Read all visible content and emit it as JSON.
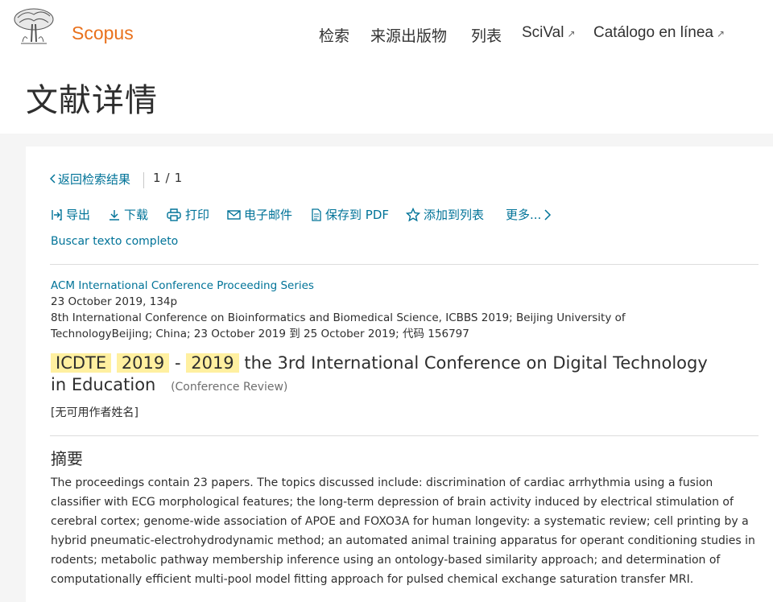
{
  "header": {
    "brand": "Scopus",
    "nav": [
      {
        "label": "检索",
        "external": false
      },
      {
        "label": "来源出版物",
        "external": false
      },
      {
        "label": "列表",
        "external": false
      },
      {
        "label": "SciVal",
        "external": true
      },
      {
        "label": "Catálogo en línea",
        "external": true
      }
    ],
    "external_icon": "↗",
    "page_title": "文献详情"
  },
  "toolbar": {
    "back_label": "返回检索结果",
    "pager_current": "1",
    "pager_sep": "/",
    "pager_total": "1",
    "actions": [
      {
        "label": "导出",
        "icon": "export-icon"
      },
      {
        "label": "下载",
        "icon": "download-icon"
      },
      {
        "label": "打印",
        "icon": "print-icon"
      },
      {
        "label": "电子邮件",
        "icon": "email-icon"
      },
      {
        "label": "保存到 PDF",
        "icon": "pdf-icon"
      },
      {
        "label": "添加到列表",
        "icon": "star-icon"
      },
      {
        "label": "更多...",
        "icon": "chevron-right-icon"
      }
    ],
    "fulltext_link": "Buscar texto completo"
  },
  "document": {
    "series": "ACM International Conference Proceeding Series",
    "date_pages": "23 October 2019, 134p",
    "conference_line1": "8th International Conference on Bioinformatics and Biomedical Science, ICBBS 2019; Beijing University of",
    "conference_line2": "TechnologyBeijing; China; 23 October 2019 到 25 October 2019; 代码 156797",
    "title_hl_1": "ICDTE",
    "title_hl_2": "2019",
    "title_dash": "-",
    "title_hl_3": "2019",
    "title_rest": "the 3rd International Conference on Digital Technology in Education",
    "doc_type": "(Conference Review)",
    "authors": "[无可用作者姓名]",
    "abstract_heading": "摘要",
    "abstract": "The proceedings contain 23 papers. The topics discussed include: discrimination of cardiac arrhythmia using a fusion classifier with ECG morphological features; the long-term depression of brain activity induced by electrical stimulation of cerebral cortex; genome-wide association of APOE and FOXO3A for human longevity: a systematic review; cell printing by a hybrid pneumatic-electrohydrodynamic method; an automated animal training apparatus for operant conditioning studies in rodents; metabolic pathway membership inference using an ontology-based similarity approach; and determination of computationally efficient multi-pool model fitting approach for pulsed chemical exchange saturation transfer MRI."
  },
  "colors": {
    "brand": "#e9711c",
    "link": "#007398",
    "highlight": "#fff0a0"
  }
}
